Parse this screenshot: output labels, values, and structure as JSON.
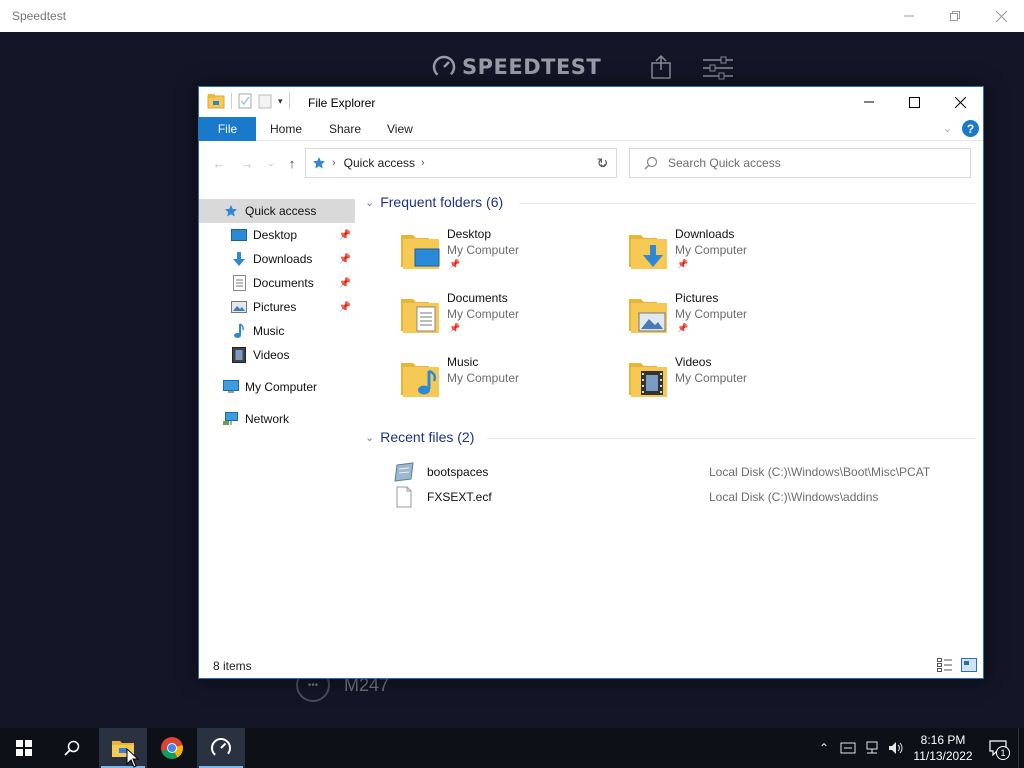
{
  "speedtest": {
    "window_title": "Speedtest",
    "logo_text": "SPEEDTEST",
    "server_name": "M247"
  },
  "explorer": {
    "title": "File Explorer",
    "ribbon_tabs": [
      "File",
      "Home",
      "Share",
      "View"
    ],
    "address": "Quick access",
    "search_placeholder": "Search Quick access",
    "nav": {
      "quick_access": "Quick access",
      "items": [
        {
          "label": "Desktop",
          "icon": "desktop-icon",
          "pinned": true
        },
        {
          "label": "Downloads",
          "icon": "downloads-icon",
          "pinned": true
        },
        {
          "label": "Documents",
          "icon": "documents-icon",
          "pinned": true
        },
        {
          "label": "Pictures",
          "icon": "pictures-icon",
          "pinned": true
        },
        {
          "label": "Music",
          "icon": "music-icon",
          "pinned": false
        },
        {
          "label": "Videos",
          "icon": "videos-icon",
          "pinned": false
        }
      ],
      "my_computer": "My Computer",
      "network": "Network"
    },
    "frequent": {
      "header": "Frequent folders (6)",
      "folders": [
        {
          "name": "Desktop",
          "location": "My Computer",
          "pinned": true
        },
        {
          "name": "Downloads",
          "location": "My Computer",
          "pinned": true
        },
        {
          "name": "Documents",
          "location": "My Computer",
          "pinned": true
        },
        {
          "name": "Pictures",
          "location": "My Computer",
          "pinned": true
        },
        {
          "name": "Music",
          "location": "My Computer",
          "pinned": false
        },
        {
          "name": "Videos",
          "location": "My Computer",
          "pinned": false
        }
      ]
    },
    "recent": {
      "header": "Recent files (2)",
      "files": [
        {
          "name": "bootspaces",
          "path": "Local Disk (C:)\\Windows\\Boot\\Misc\\PCAT"
        },
        {
          "name": "FXSEXT.ecf",
          "path": "Local Disk (C:)\\Windows\\addins"
        }
      ]
    },
    "status_items": "8 items"
  },
  "taskbar": {
    "time": "8:16 PM",
    "date": "11/13/2022",
    "notification_count": "1"
  },
  "colors": {
    "accent": "#1979ca",
    "folder_yellow": "#f5c953",
    "group_header": "#1e3287"
  }
}
